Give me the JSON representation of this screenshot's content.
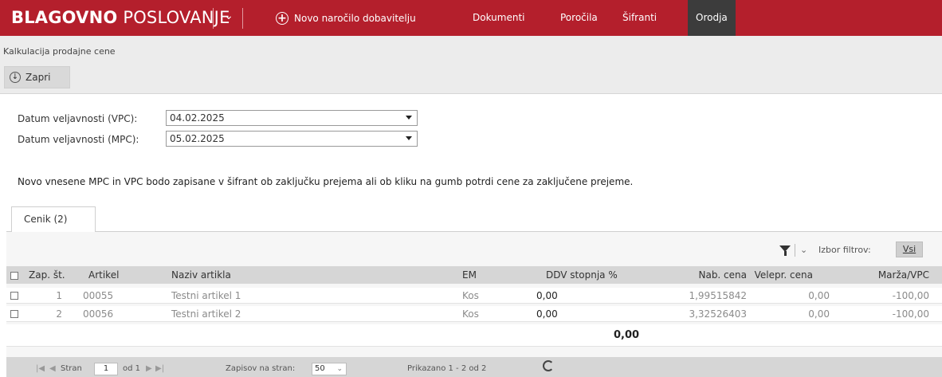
{
  "app": {
    "title_bold": "BLAGOVNO",
    "title_light": "POSLOVANJE",
    "new_order_label": "Novo naročilo dobavitelju",
    "nav": [
      "Dokumenti",
      "Poročila",
      "Šifranti",
      "Orodja"
    ],
    "active_nav": "Orodja",
    "accent_color": "#b41f2c"
  },
  "page": {
    "title": "Kalkulacija prodajne cene",
    "close_label": "Zapri"
  },
  "form": {
    "vpc_label": "Datum veljavnosti (VPC):",
    "vpc_value": "04.02.2025",
    "mpc_label": "Datum veljavnosti (MPC):",
    "mpc_value": "05.02.2025",
    "note": "Novo vnesene MPC in VPC bodo zapisane v šifrant ob zaključku prejema ali ob kliku na gumb potrdi cene za zaključene prejeme."
  },
  "tabs": [
    "Cenik (2)"
  ],
  "filter": {
    "label": "Izbor filtrov:",
    "value": "Vsi"
  },
  "grid": {
    "columns": [
      "Zap. št.",
      "Artikel",
      "Naziv artikla",
      "EM",
      "DDV stopnja %",
      "Nab. cena",
      "Velepr. cena",
      "Marža/VPC"
    ],
    "rows": [
      {
        "zap": "1",
        "artikel": "00055",
        "naziv": "Testni artikel 1",
        "em": "Kos",
        "ddv": "0,00",
        "nab": "1,99515842",
        "velepr": "0,00",
        "marza": "-100,00"
      },
      {
        "zap": "2",
        "artikel": "00056",
        "naziv": "Testni artikel 2",
        "em": "Kos",
        "ddv": "0,00",
        "nab": "3,32526403",
        "velepr": "0,00",
        "marza": "-100,00"
      }
    ],
    "ddv_total": "0,00"
  },
  "pager": {
    "page_label": "Stran",
    "page_value": "1",
    "of_label": "od 1",
    "per_page_label": "Zapisov na stran:",
    "per_page_value": "50",
    "summary": "Prikazano 1 - 2 od 2"
  }
}
